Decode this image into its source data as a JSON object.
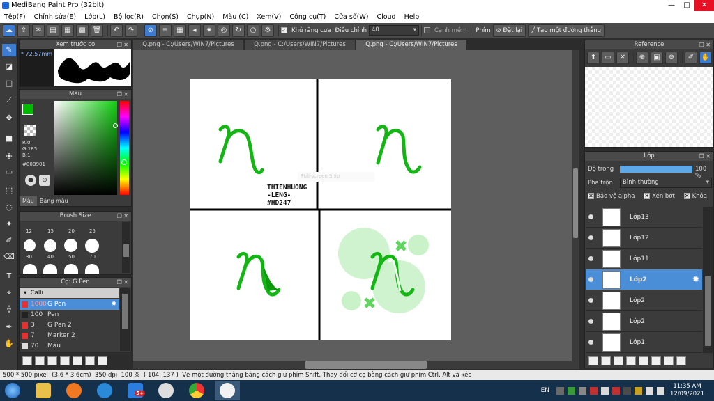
{
  "window": {
    "title": "MediBang Paint Pro (32bit)",
    "minimize": "—",
    "maximize": "□",
    "close": "✕"
  },
  "menu": [
    "Tệp(F)",
    "Chỉnh sửa(E)",
    "Lớp(L)",
    "Bộ lọc(R)",
    "Chọn(S)",
    "Chụp(N)",
    "Màu (C)",
    "Xem(V)",
    "Công cụ(T)",
    "Cửa sổ(W)",
    "Cloud",
    "Help"
  ],
  "toolbar": {
    "antialias_label": "Khử răng cưa",
    "correction_label": "Điều chỉnh",
    "correction_value": "40",
    "edge_label": "Cạnh mềm",
    "key_label": "Phím",
    "reset_label": "Đặt lại",
    "line_label": "Tạo một đường thẳng"
  },
  "tabs": [
    "Q.png - C:/Users/WIN7/Pictures",
    "Q.png - C:/Users/WIN7/Pictures",
    "Q.png - C:/Users/WIN7/Pictures"
  ],
  "brush_preview": {
    "title": "Xem trước cọ",
    "size": "* 72.57mm"
  },
  "color_panel": {
    "title": "Màu",
    "r": "R:0",
    "g": "G:185",
    "b": "B:1",
    "hex": "#00B901",
    "tab_color": "Màu",
    "tab_palette": "Bảng màu",
    "fg": "#00B901",
    "bg": "#7fa0d8"
  },
  "brush_size": {
    "title": "Brush Size",
    "row1": [
      "12",
      "15",
      "20",
      "25"
    ],
    "row2": [
      "30",
      "40",
      "50",
      "70"
    ]
  },
  "brush_list": {
    "title": "Cọ: G Pen",
    "group": "Calli",
    "items": [
      {
        "size": "1000",
        "name": "G Pen",
        "selected": true
      },
      {
        "size": "100",
        "name": "Pen",
        "selected": false
      },
      {
        "size": "3",
        "name": "G Pen 2",
        "selected": false
      },
      {
        "size": "7",
        "name": "Marker 2",
        "selected": false
      },
      {
        "size": "70",
        "name": "Màu",
        "selected": false
      }
    ]
  },
  "artwork": {
    "watermark_line1": "THIENHUONG",
    "watermark_line2": "-LENG-",
    "watermark_line3": "#HD247",
    "snip_label": "Full-screen Snip",
    "glyph": "ɲ"
  },
  "reference": {
    "title": "Reference"
  },
  "layers": {
    "title": "Lớp",
    "opacity_label": "Độ trong",
    "opacity_value": "100 %",
    "opacity": 100,
    "blend_label": "Pha trộn",
    "blend_value": "Bình thường",
    "protect_alpha": "Bảo vệ alpha",
    "clipping": "Xén bớt",
    "lock": "Khóa",
    "items": [
      {
        "name": "Lớp13",
        "selected": false
      },
      {
        "name": "Lớp12",
        "selected": false
      },
      {
        "name": "Lớp11",
        "selected": false
      },
      {
        "name": "Lớp2",
        "selected": true
      },
      {
        "name": "Lớp2",
        "selected": false
      },
      {
        "name": "Lớp2",
        "selected": false
      },
      {
        "name": "Lớp1",
        "selected": false
      }
    ]
  },
  "status": {
    "size": "500 * 500 pixel",
    "physical": "(3.6 * 3.6cm)",
    "dpi": "350 dpi",
    "zoom": "100 %",
    "coords": "( 104, 137 )",
    "hint": "Vẽ một đường thẳng bằng cách giữ phím Shift, Thay đổi cỡ cọ bằng cách giữ phím Ctrl, Alt và kéo"
  },
  "taskbar": {
    "lang": "EN",
    "time": "11:35 AM",
    "date": "12/09/2021",
    "zalo_badge": "5+"
  }
}
